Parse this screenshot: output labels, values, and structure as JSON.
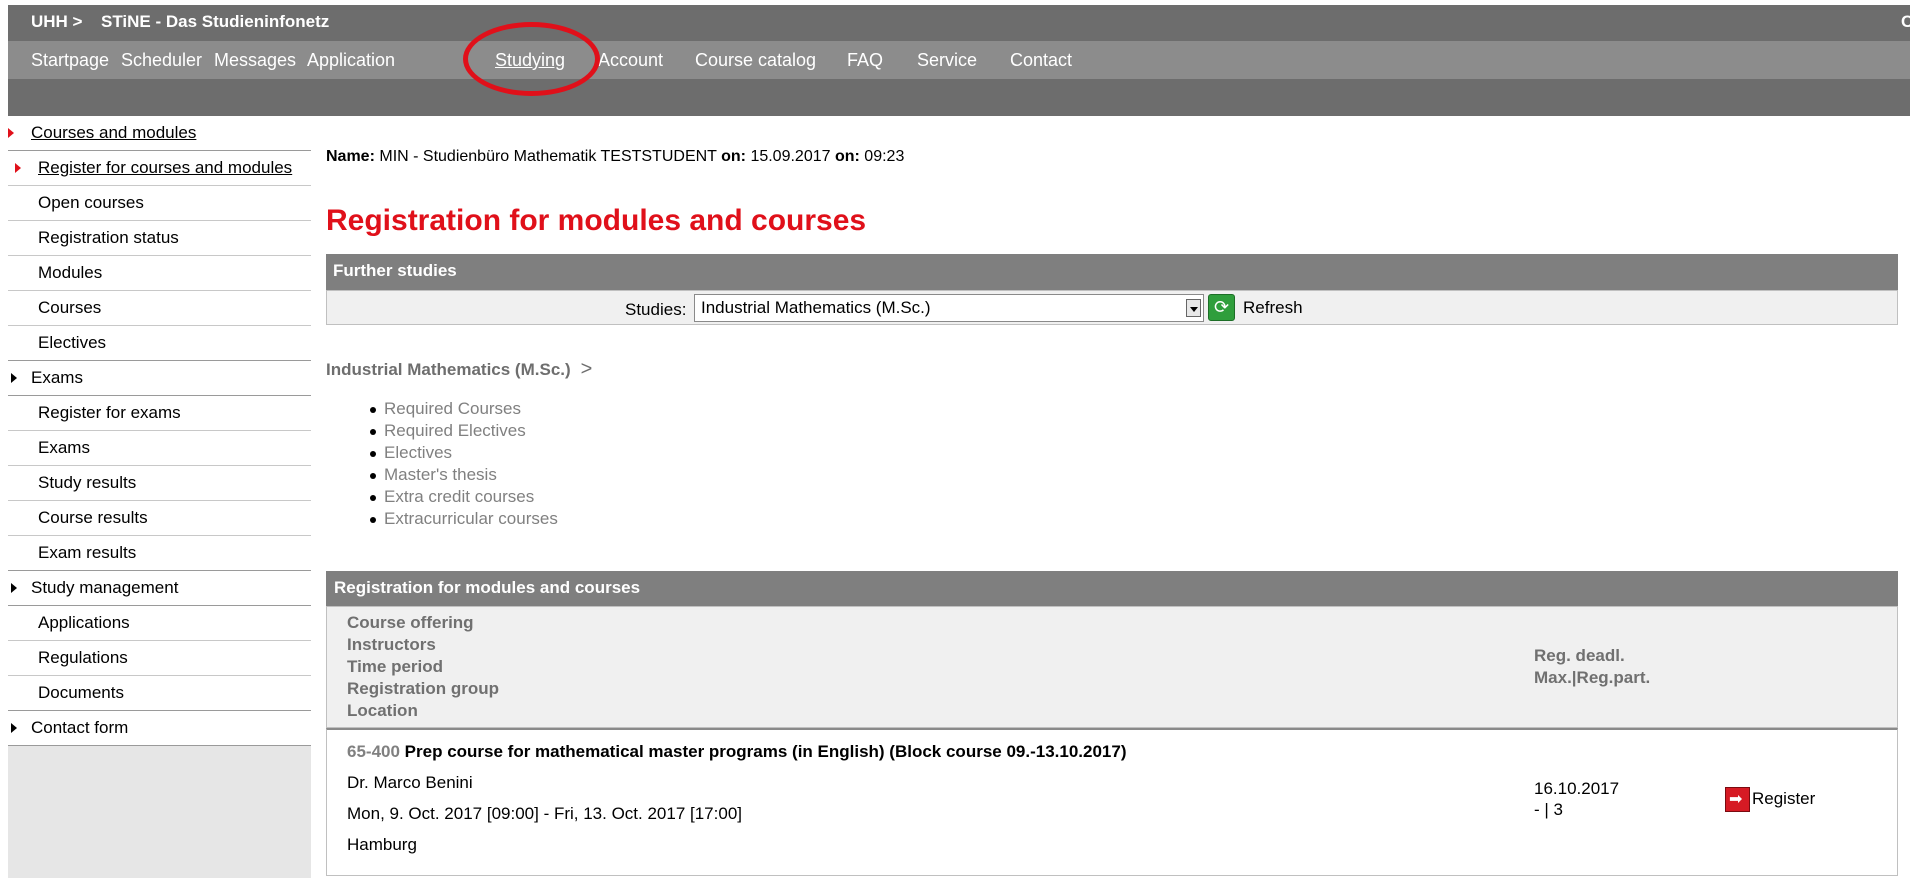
{
  "header": {
    "uhh_label": "UHH >",
    "site_title": "STiNE - Das Studieninfonetz",
    "right_cut": "C"
  },
  "nav": {
    "items": [
      "Startpage",
      "Scheduler",
      "Messages",
      "Application",
      "Studying",
      "Account",
      "Course catalog",
      "FAQ",
      "Service",
      "Contact"
    ],
    "active": "Studying"
  },
  "sidebar": {
    "items": [
      {
        "label": "Courses and modules",
        "type": "main"
      },
      {
        "label": "Register for courses and modules",
        "type": "sub"
      },
      {
        "label": "Open courses",
        "type": "sub"
      },
      {
        "label": "Registration status",
        "type": "sub"
      },
      {
        "label": "Modules",
        "type": "sub"
      },
      {
        "label": "Courses",
        "type": "sub"
      },
      {
        "label": "Electives",
        "type": "sub"
      },
      {
        "label": "Exams",
        "type": "main"
      },
      {
        "label": "Register for exams",
        "type": "sub"
      },
      {
        "label": "Exams",
        "type": "sub"
      },
      {
        "label": "Study results",
        "type": "sub"
      },
      {
        "label": "Course results",
        "type": "sub"
      },
      {
        "label": "Exam results",
        "type": "sub"
      },
      {
        "label": "Study management",
        "type": "main"
      },
      {
        "label": "Applications",
        "type": "sub"
      },
      {
        "label": "Regulations",
        "type": "sub"
      },
      {
        "label": "Documents",
        "type": "sub"
      },
      {
        "label": "Contact form",
        "type": "main"
      }
    ]
  },
  "info": {
    "name_label": "Name:",
    "name_value": "MIN - Studienbüro Mathematik TESTSTUDENT",
    "on_label_1": "on:",
    "date": "15.09.2017",
    "on_label_2": "on:",
    "time": "09:23"
  },
  "page_title": "Registration for modules and courses",
  "further_studies": {
    "header": "Further studies",
    "studies_label": "Studies:",
    "selected": "Industrial Mathematics (M.Sc.)",
    "refresh_label": "Refresh"
  },
  "breadcrumb": {
    "program": "Industrial Mathematics (M.Sc.)",
    "sep": ">"
  },
  "categories": [
    "Required Courses",
    "Required Electives",
    "Electives",
    "Master's thesis",
    "Extra credit courses",
    "Extracurricular courses"
  ],
  "registration": {
    "header": "Registration for modules and courses",
    "columns": {
      "left": [
        "Course offering",
        "Instructors",
        "Time period",
        "Registration group",
        "Location"
      ],
      "right": [
        "Reg. deadl.",
        "Max.|Reg.part."
      ]
    },
    "row": {
      "code": "65-400",
      "title": "Prep course for mathematical master programs (in English) (Block course 09.-13.10.2017)",
      "instructor": "Dr. Marco Benini",
      "period": "Mon, 9. Oct. 2017 [09:00] - Fri, 13. Oct. 2017 [17:00]",
      "location": "Hamburg",
      "deadline": "16.10.2017",
      "max_reg": "- | 3",
      "register_label": "Register"
    }
  },
  "colors": {
    "accent_red": "#e0101a",
    "header_gray": "#6d6d6d",
    "nav_gray": "#8c8c8c"
  }
}
